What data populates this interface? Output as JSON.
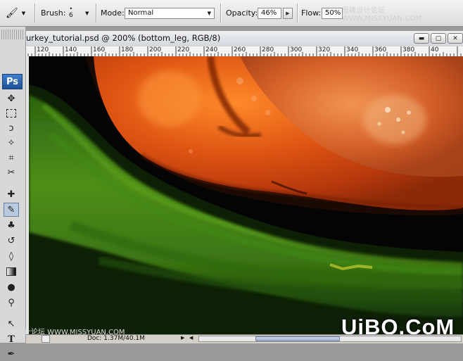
{
  "options_bar": {
    "brush_label": "Brush:",
    "brush_size": "6",
    "mode_label": "Mode:",
    "mode_value": "Normal",
    "opacity_label": "Opacity:",
    "opacity_value": "46%",
    "flow_label": "Flow:",
    "flow_value": "50%"
  },
  "watermark_top": "思缘设计论坛 WWW.MISSYUAN.COM",
  "watermark_bottom": "思缘设计论坛 WWW.MISSYUAN.COM",
  "brand": "UiBQ.CoM",
  "document": {
    "title": "urkey_tutorial.psd @ 200% (bottom_leg, RGB/8)",
    "minimize": "▬",
    "maximize": "▢",
    "close": "✕"
  },
  "ruler": {
    "labels": [
      "120",
      "140",
      "160",
      "180",
      "200",
      "220",
      "240",
      "260",
      "280",
      "300",
      "320",
      "340",
      "360",
      "380",
      "40"
    ]
  },
  "tools_panel": {
    "logo": "Ps",
    "icons": [
      "move-icon",
      "marquee-icon",
      "lasso-icon",
      "magic-wand-icon",
      "crop-icon",
      "slice-icon",
      "healing-icon",
      "brush-icon",
      "stamp-icon",
      "history-brush-icon",
      "eraser-icon",
      "gradient-icon",
      "blur-icon",
      "dodge-icon",
      "path-select-icon",
      "type-icon",
      "pen-icon"
    ]
  },
  "status": {
    "doc_info": "Doc: 1.37M/40.1M"
  }
}
